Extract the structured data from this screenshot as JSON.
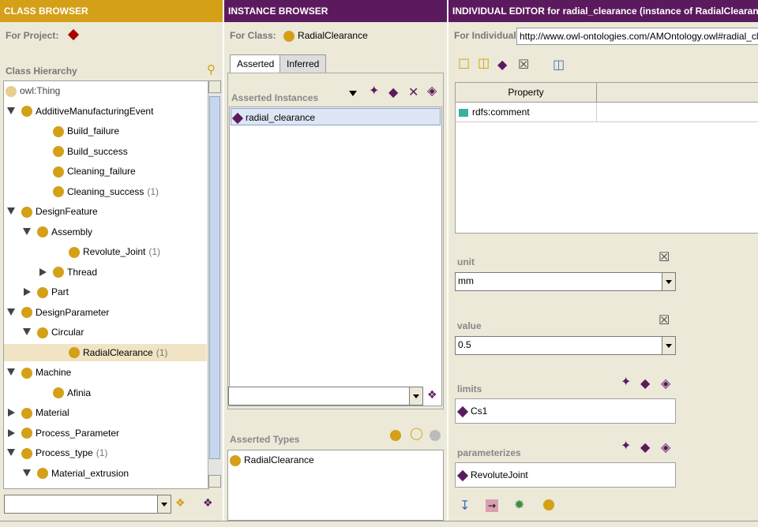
{
  "class_browser": {
    "title": "CLASS BROWSER",
    "for_project_label": "For Project:",
    "hierarchy_label": "Class Hierarchy",
    "tree": [
      {
        "label": "owl:Thing",
        "count": "",
        "indent": 0,
        "toggle": "none",
        "selected": false
      },
      {
        "label": "AdditiveManufacturingEvent",
        "count": "",
        "indent": 0,
        "toggle": "down",
        "selected": false
      },
      {
        "label": "Build_failure",
        "count": "",
        "indent": 2,
        "toggle": "none",
        "selected": false
      },
      {
        "label": "Build_success",
        "count": "",
        "indent": 2,
        "toggle": "none",
        "selected": false
      },
      {
        "label": "Cleaning_failure",
        "count": "",
        "indent": 2,
        "toggle": "none",
        "selected": false
      },
      {
        "label": "Cleaning_success",
        "count": "(1)",
        "indent": 2,
        "toggle": "none",
        "selected": false
      },
      {
        "label": "DesignFeature",
        "count": "",
        "indent": 0,
        "toggle": "down",
        "selected": false
      },
      {
        "label": "Assembly",
        "count": "",
        "indent": 1,
        "toggle": "down",
        "selected": false
      },
      {
        "label": "Revolute_Joint",
        "count": "(1)",
        "indent": 3,
        "toggle": "none",
        "selected": false
      },
      {
        "label": "Thread",
        "count": "",
        "indent": 2,
        "toggle": "right",
        "selected": false
      },
      {
        "label": "Part",
        "count": "",
        "indent": 1,
        "toggle": "right",
        "selected": false
      },
      {
        "label": "DesignParameter",
        "count": "",
        "indent": 0,
        "toggle": "down",
        "selected": false
      },
      {
        "label": "Circular",
        "count": "",
        "indent": 1,
        "toggle": "down",
        "selected": false
      },
      {
        "label": "RadialClearance",
        "count": "(1)",
        "indent": 3,
        "toggle": "none",
        "selected": true
      },
      {
        "label": "Machine",
        "count": "",
        "indent": 0,
        "toggle": "down",
        "selected": false
      },
      {
        "label": "Afinia",
        "count": "",
        "indent": 2,
        "toggle": "none",
        "selected": false
      },
      {
        "label": "Material",
        "count": "",
        "indent": 0,
        "toggle": "right",
        "selected": false
      },
      {
        "label": "Process_Parameter",
        "count": "",
        "indent": 0,
        "toggle": "right",
        "selected": false
      },
      {
        "label": "Process_type",
        "count": "(1)",
        "indent": 0,
        "toggle": "down",
        "selected": false
      },
      {
        "label": "Material_extrusion",
        "count": "",
        "indent": 1,
        "toggle": "down",
        "selected": false
      }
    ]
  },
  "instance_browser": {
    "title": "INSTANCE BROWSER",
    "for_class_label": "For Class:",
    "for_class_value": "RadialClearance",
    "tabs": [
      "Asserted",
      "Inferred"
    ],
    "active_tab": "Asserted",
    "asserted_instances_label": "Asserted Instances",
    "instances": [
      "radial_clearance"
    ],
    "asserted_types_label": "Asserted Types",
    "types": [
      "RadialClearance"
    ]
  },
  "individual_editor": {
    "title": "INDIVIDUAL EDITOR for radial_clearance   (instance of RadialClearance)",
    "for_individual_label": "For Individual:",
    "for_individual_value": "http://www.owl-ontologies.com/AMOntology.owl#radial_clearance",
    "table_header": "Property",
    "properties": [
      {
        "name": "rdfs:comment",
        "value": ""
      }
    ],
    "unit_label": "unit",
    "unit_value": "mm",
    "value_label": "value",
    "value_value": "0.5",
    "limits_label": "limits",
    "limits_values": [
      "Cs1"
    ],
    "parameterizes_label": "parameterizes",
    "parameterizes_values": [
      "RevoluteJoint"
    ]
  },
  "colors": {
    "class_title_bg": "#d4a017",
    "instance_title_bg": "#5c1a5e",
    "class_ball": "#d4a017",
    "instance_diamond": "#5c1a5e",
    "selection": "#f0e4c4"
  },
  "icons": [
    "search-icon",
    "binoculars-icon",
    "add-instance-icon",
    "delete-icon",
    "create-class-icon",
    "add-restriction-icon"
  ]
}
